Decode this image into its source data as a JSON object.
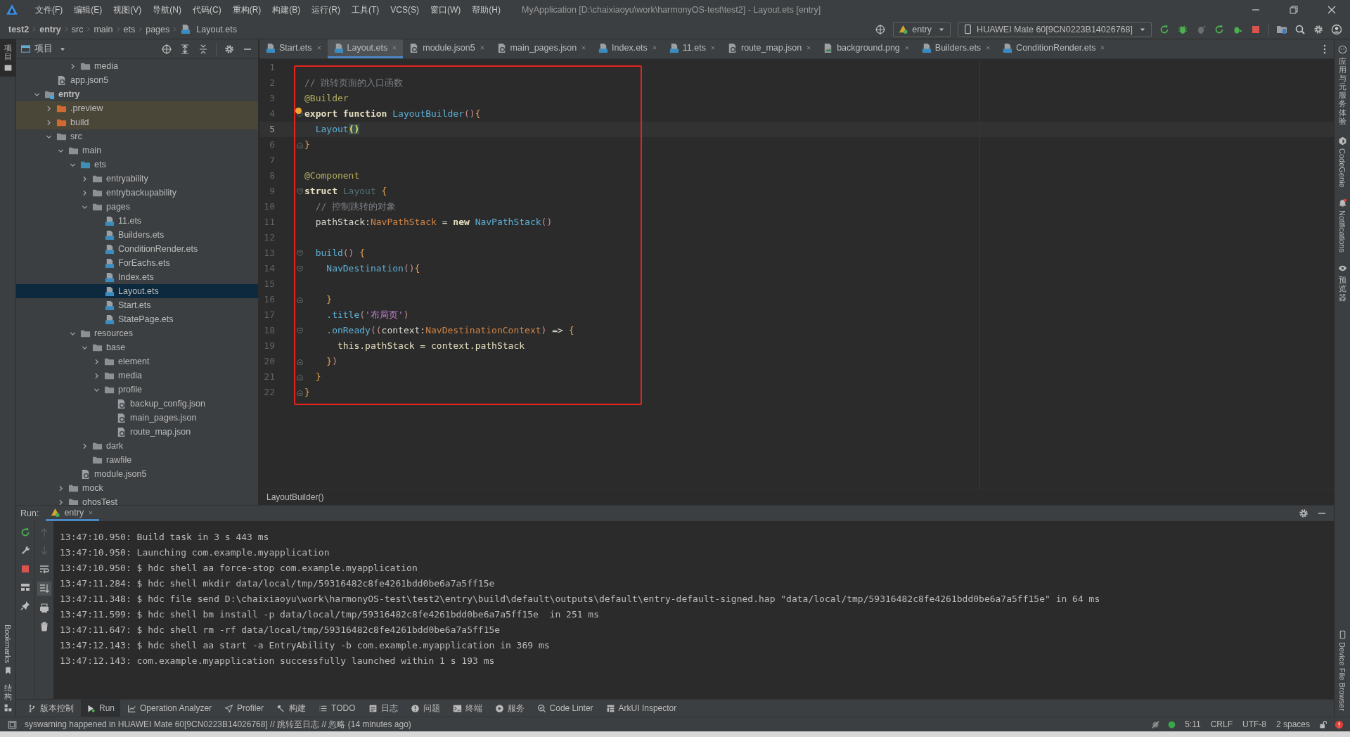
{
  "window": {
    "title": "MyApplication [D:\\chaixiaoyu\\work\\harmonyOS-test\\test2] - Layout.ets [entry]"
  },
  "menu": [
    "文件(F)",
    "编辑(E)",
    "视图(V)",
    "导航(N)",
    "代码(C)",
    "重构(R)",
    "构建(B)",
    "运行(R)",
    "工具(T)",
    "VCS(S)",
    "窗口(W)",
    "帮助(H)"
  ],
  "breadcrumb": [
    {
      "label": "test2",
      "kind": "bold"
    },
    {
      "label": "entry",
      "kind": "bold"
    },
    {
      "label": "src",
      "kind": "plain"
    },
    {
      "label": "main",
      "kind": "plain"
    },
    {
      "label": "ets",
      "kind": "plain"
    },
    {
      "label": "pages",
      "kind": "plain"
    },
    {
      "label": "Layout.ets",
      "kind": "file"
    }
  ],
  "toolbar": {
    "run_config": "entry",
    "device": "HUAWEI Mate 60[9CN0223B14026768]"
  },
  "left_strip": {
    "top": [
      {
        "label": "项目",
        "selected": true
      }
    ],
    "bottom": [
      {
        "label": "Bookmarks",
        "selected": false
      },
      {
        "label": "结构",
        "selected": false
      }
    ]
  },
  "right_strip": {
    "top": [
      {
        "label": "应用与元服务体验"
      },
      {
        "label": "CodeGenie"
      },
      {
        "label": "Notifications"
      },
      {
        "label": "预览器"
      }
    ],
    "bottom": [
      {
        "label": "Device File Browser"
      }
    ]
  },
  "project_panel": {
    "title": "项目",
    "tree": [
      {
        "children": [
          {
            "children": [
              {
                "children": [
                  {
                    "label": "media",
                    "kind": "folder",
                    "expanded": false,
                    "selected": false
                  }
                ]
              }
            ]
          },
          {
            "label": "app.json5",
            "kind": "json",
            "selected": false
          }
        ]
      },
      {
        "label": "entry",
        "kind": "module",
        "expanded": true,
        "selected": false,
        "children": [
          {
            "label": ".preview",
            "kind": "excluded",
            "expanded": false,
            "selected": false
          },
          {
            "label": "build",
            "kind": "excluded",
            "expanded": false,
            "selected": false
          },
          {
            "label": "src",
            "kind": "folder",
            "expanded": true,
            "selected": false,
            "children": [
              {
                "label": "main",
                "kind": "folder",
                "expanded": true,
                "selected": false,
                "children": [
                  {
                    "label": "ets",
                    "kind": "source",
                    "expanded": true,
                    "selected": false,
                    "children": [
                      {
                        "label": "entryability",
                        "kind": "folder",
                        "expanded": false,
                        "selected": false
                      },
                      {
                        "label": "entrybackupability",
                        "kind": "folder",
                        "expanded": false,
                        "selected": false
                      },
                      {
                        "label": "pages",
                        "kind": "folder",
                        "expanded": true,
                        "selected": false,
                        "children": [
                          {
                            "label": "11.ets",
                            "kind": "ets",
                            "selected": false
                          },
                          {
                            "label": "Builders.ets",
                            "kind": "ets",
                            "selected": false
                          },
                          {
                            "label": "ConditionRender.ets",
                            "kind": "ets",
                            "selected": false
                          },
                          {
                            "label": "ForEachs.ets",
                            "kind": "ets",
                            "selected": false
                          },
                          {
                            "label": "Index.ets",
                            "kind": "ets",
                            "selected": false
                          },
                          {
                            "label": "Layout.ets",
                            "kind": "ets",
                            "selected": true
                          },
                          {
                            "label": "Start.ets",
                            "kind": "ets",
                            "selected": false
                          },
                          {
                            "label": "StatePage.ets",
                            "kind": "ets",
                            "selected": false
                          }
                        ]
                      }
                    ]
                  },
                  {
                    "label": "resources",
                    "kind": "folder",
                    "expanded": true,
                    "selected": false,
                    "children": [
                      {
                        "label": "base",
                        "kind": "folder",
                        "expanded": true,
                        "selected": false,
                        "children": [
                          {
                            "label": "element",
                            "kind": "folder",
                            "expanded": false,
                            "selected": false
                          },
                          {
                            "label": "media",
                            "kind": "folder",
                            "expanded": false,
                            "selected": false
                          },
                          {
                            "label": "profile",
                            "kind": "folder",
                            "expanded": true,
                            "selected": false,
                            "children": [
                              {
                                "label": "backup_config.json",
                                "kind": "json",
                                "selected": false
                              },
                              {
                                "label": "main_pages.json",
                                "kind": "json",
                                "selected": false
                              },
                              {
                                "label": "route_map.json",
                                "kind": "json",
                                "selected": false
                              }
                            ]
                          }
                        ]
                      },
                      {
                        "label": "dark",
                        "kind": "folder",
                        "expanded": false,
                        "selected": false
                      },
                      {
                        "label": "rawfile",
                        "kind": "folder",
                        "selected": false
                      }
                    ]
                  },
                  {
                    "label": "module.json5",
                    "kind": "json",
                    "selected": false
                  }
                ]
              },
              {
                "label": "mock",
                "kind": "folder",
                "expanded": false,
                "selected": false
              },
              {
                "label": "ohosTest",
                "kind": "folder",
                "expanded": false,
                "selected": false
              }
            ]
          }
        ]
      }
    ]
  },
  "editor": {
    "tabs": [
      {
        "label": "Start.ets",
        "kind": "ets",
        "selected": false
      },
      {
        "label": "Layout.ets",
        "kind": "ets",
        "selected": true
      },
      {
        "label": "module.json5",
        "kind": "json",
        "selected": false
      },
      {
        "label": "main_pages.json",
        "kind": "json",
        "selected": false
      },
      {
        "label": "Index.ets",
        "kind": "ets",
        "selected": false
      },
      {
        "label": "11.ets",
        "kind": "ets",
        "selected": false
      },
      {
        "label": "route_map.json",
        "kind": "json",
        "selected": false
      },
      {
        "label": "background.png",
        "kind": "png",
        "selected": false
      },
      {
        "label": "Builders.ets",
        "kind": "ets",
        "selected": false
      },
      {
        "label": "ConditionRender.ets",
        "kind": "ets",
        "selected": false
      }
    ],
    "lines": [
      {
        "number": "1",
        "current": false,
        "bulb": false
      },
      {
        "number": "2",
        "current": false,
        "bulb": false,
        "tokens": [
          {
            "t": "// 跳转页面的入口函数",
            "kind": "comment"
          }
        ]
      },
      {
        "number": "3",
        "current": false,
        "bulb": false,
        "tokens": [
          {
            "t": "@Builder",
            "kind": "annotation"
          }
        ]
      },
      {
        "number": "4",
        "kind": "fold-open",
        "current": false,
        "bulb": true,
        "tokens": [
          {
            "t": "export function ",
            "kind": "keyword"
          },
          {
            "t": "LayoutBuilder",
            "kind": "call"
          },
          {
            "t": "()",
            "kind": "paren"
          },
          {
            "t": "{",
            "kind": "brace"
          }
        ]
      },
      {
        "number": "5",
        "current": true,
        "bulb": false,
        "tokens": [
          {
            "t": "  Layout",
            "kind": "call"
          },
          {
            "t": "()",
            "kind": "match"
          }
        ]
      },
      {
        "number": "6",
        "kind": "fold-close",
        "current": false,
        "bulb": false,
        "tokens": [
          {
            "t": "}",
            "kind": "brace"
          }
        ]
      },
      {
        "number": "7",
        "current": false,
        "bulb": false
      },
      {
        "number": "8",
        "current": false,
        "bulb": false,
        "tokens": [
          {
            "t": "@Component",
            "kind": "annotation"
          }
        ]
      },
      {
        "number": "9",
        "kind": "fold-open",
        "current": false,
        "bulb": false,
        "tokens": [
          {
            "t": "struct ",
            "kind": "keyword"
          },
          {
            "t": "Layout",
            "kind": "unused"
          },
          {
            "t": " {",
            "kind": "brace"
          }
        ]
      },
      {
        "number": "10",
        "current": false,
        "bulb": false,
        "tokens": [
          {
            "t": "  // 控制跳转的对象",
            "kind": "comment"
          }
        ]
      },
      {
        "number": "11",
        "current": false,
        "bulb": false,
        "tokens": [
          {
            "t": "  pathStack:",
            "kind": "plain"
          },
          {
            "t": "NavPathStack",
            "kind": "type"
          },
          {
            "t": " = ",
            "kind": "plain"
          },
          {
            "t": "new ",
            "kind": "keyword"
          },
          {
            "t": "NavPathStack",
            "kind": "call"
          },
          {
            "t": "()",
            "kind": "paren"
          }
        ]
      },
      {
        "number": "12",
        "current": false,
        "bulb": false
      },
      {
        "number": "13",
        "kind": "fold-open",
        "current": false,
        "bulb": false,
        "tokens": [
          {
            "t": "  build",
            "kind": "call"
          },
          {
            "t": "()",
            "kind": "paren"
          },
          {
            "t": " {",
            "kind": "brace"
          }
        ]
      },
      {
        "number": "14",
        "kind": "fold-open",
        "current": false,
        "bulb": false,
        "tokens": [
          {
            "t": "    NavDestination",
            "kind": "call"
          },
          {
            "t": "()",
            "kind": "paren"
          },
          {
            "t": "{",
            "kind": "brace"
          }
        ]
      },
      {
        "number": "15",
        "current": false,
        "bulb": false
      },
      {
        "number": "16",
        "kind": "fold-close",
        "current": false,
        "bulb": false,
        "tokens": [
          {
            "t": "    }",
            "kind": "brace"
          }
        ]
      },
      {
        "number": "17",
        "current": false,
        "bulb": false,
        "tokens": [
          {
            "t": "    .title",
            "kind": "call"
          },
          {
            "t": "(",
            "kind": "paren"
          },
          {
            "t": "'布局页'",
            "kind": "string"
          },
          {
            "t": ")",
            "kind": "paren"
          }
        ]
      },
      {
        "number": "18",
        "kind": "fold-open",
        "current": false,
        "bulb": false,
        "tokens": [
          {
            "t": "    .onReady",
            "kind": "call"
          },
          {
            "t": "((",
            "kind": "paren"
          },
          {
            "t": "context:",
            "kind": "plain"
          },
          {
            "t": "NavDestinationContext",
            "kind": "type"
          },
          {
            "t": ")",
            "kind": "paren"
          },
          {
            "t": " => ",
            "kind": "plain"
          },
          {
            "t": "{",
            "kind": "brace"
          }
        ]
      },
      {
        "number": "19",
        "current": false,
        "bulb": false,
        "tokens": [
          {
            "t": "      this.pathStack = context.pathStack",
            "kind": "field"
          }
        ]
      },
      {
        "number": "20",
        "kind": "fold-close",
        "current": false,
        "bulb": false,
        "tokens": [
          {
            "t": "    }",
            "kind": "brace"
          },
          {
            "t": ")",
            "kind": "paren"
          }
        ]
      },
      {
        "number": "21",
        "kind": "fold-close",
        "current": false,
        "bulb": false,
        "tokens": [
          {
            "t": "  }",
            "kind": "brace"
          }
        ]
      },
      {
        "number": "22",
        "kind": "fold-close",
        "current": false,
        "bulb": false,
        "tokens": [
          {
            "t": "}",
            "kind": "brace"
          }
        ]
      }
    ],
    "breadcrumb": "LayoutBuilder()"
  },
  "run_panel": {
    "title": "Run:",
    "tab": "entry",
    "console": [
      "13:47:10.950: Build task in 3 s 443 ms",
      "13:47:10.950: Launching com.example.myapplication",
      "13:47:10.950: $ hdc shell aa force-stop com.example.myapplication",
      "13:47:11.284: $ hdc shell mkdir data/local/tmp/59316482c8fe4261bdd0be6a7a5ff15e",
      "13:47:11.348: $ hdc file send D:\\chaixiaoyu\\work\\harmonyOS-test\\test2\\entry\\build\\default\\outputs\\default\\entry-default-signed.hap \"data/local/tmp/59316482c8fe4261bdd0be6a7a5ff15e\" in 64 ms",
      "13:47:11.599: $ hdc shell bm install -p data/local/tmp/59316482c8fe4261bdd0be6a7a5ff15e  in 251 ms",
      "13:47:11.647: $ hdc shell rm -rf data/local/tmp/59316482c8fe4261bdd0be6a7a5ff15e",
      "13:47:12.143: $ hdc shell aa start -a EntryAbility -b com.example.myapplication in 369 ms",
      "13:47:12.143: com.example.myapplication successfully launched within 1 s 193 ms"
    ]
  },
  "tool_windows": [
    {
      "label": "版本控制",
      "selected": false
    },
    {
      "label": "Run",
      "selected": true
    },
    {
      "label": "Operation Analyzer",
      "selected": false
    },
    {
      "label": "Profiler",
      "selected": false
    },
    {
      "label": "构建",
      "selected": false
    },
    {
      "label": "TODO",
      "selected": false
    },
    {
      "label": "日志",
      "selected": false
    },
    {
      "label": "问题",
      "selected": false
    },
    {
      "label": "终端",
      "selected": false
    },
    {
      "label": "服务",
      "selected": false
    },
    {
      "label": "Code Linter",
      "selected": false
    },
    {
      "label": "ArkUI Inspector",
      "selected": false
    }
  ],
  "status_bar": {
    "message": "syswarning happened in HUAWEI Mate 60[9CN0223B14026768] // 跳转至日志 // 忽略 (14 minutes ago)",
    "items": [
      "5:11",
      "CRLF",
      "UTF-8",
      "2 spaces"
    ]
  }
}
